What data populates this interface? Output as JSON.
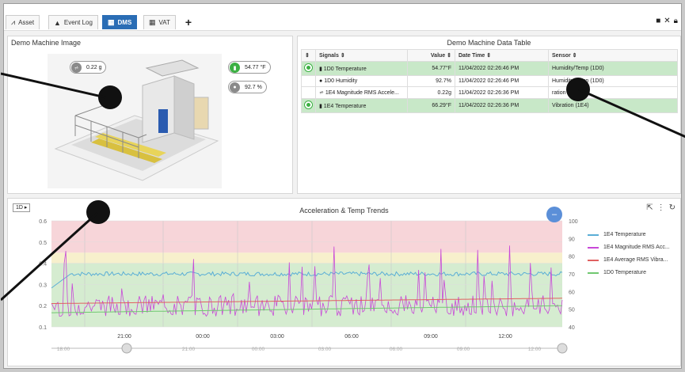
{
  "tabs": [
    {
      "label": "Asset",
      "icon": "asset-chart-icon"
    },
    {
      "label": "Event Log",
      "icon": "warning-triangle-icon"
    },
    {
      "label": "DMS",
      "icon": "dms-grid-icon"
    },
    {
      "label": "VAT",
      "icon": "vat-grid-icon"
    }
  ],
  "image_panel": {
    "title": "Demo Machine Image",
    "badges": {
      "vibration": "0.22 g",
      "temperature": "54.77 °F",
      "humidity": "92.7 %"
    }
  },
  "table_panel": {
    "title": "Demo Machine Data Table",
    "headers": [
      "Signals ⇕",
      "Value ⇕",
      "Date Time ⇕",
      "Sensor ⇕"
    ],
    "rows": [
      {
        "signal": "1D0 Temperature",
        "value": "54.77°F",
        "datetime": "11/04/2022 02:26:46 PM",
        "sensor": "Humidity/Temp (1D0)",
        "highlight": true
      },
      {
        "signal": "1D0 Humidity",
        "value": "92.7%",
        "datetime": "11/04/2022 02:26:46 PM",
        "sensor": "Humidity/Temp (1D0)",
        "highlight": false
      },
      {
        "signal": "1E4 Magnitude RMS Accele...",
        "value": "0.22g",
        "datetime": "11/04/2022 02:26:36 PM",
        "sensor": "ration (1E4)",
        "highlight": false
      },
      {
        "signal": "1E4 Temperature",
        "value": "66.29°F",
        "datetime": "11/04/2022 02:26:36 PM",
        "sensor": "Vibration (1E4)",
        "highlight": true
      }
    ]
  },
  "trend_panel": {
    "title": "Acceleration & Temp Trends",
    "range_label": "1D",
    "collapse_glyph": "–"
  },
  "chart_data": {
    "type": "line",
    "title": "Acceleration & Temp Trends",
    "x_ticks": [
      "21:00",
      "00:00",
      "03:00",
      "06:00",
      "09:00",
      "12:00"
    ],
    "navigator_ticks": [
      "18:00",
      "21:00",
      "00:00",
      "03:00",
      "06:00",
      "09:00",
      "12:00"
    ],
    "y_left": {
      "ticks": [
        0.1,
        0.2,
        0.3,
        0.4,
        0.5,
        0.6
      ],
      "range": [
        0.1,
        0.6
      ]
    },
    "y_right": {
      "ticks": [
        40,
        50,
        60,
        70,
        80,
        90,
        100
      ],
      "range": [
        40,
        100
      ]
    },
    "bands": [
      {
        "from": 0.1,
        "to": 0.4,
        "color": "#d5ecd0"
      },
      {
        "from": 0.4,
        "to": 0.45,
        "color": "#f7f0cc"
      },
      {
        "from": 0.45,
        "to": 0.6,
        "color": "#f7d5d9"
      }
    ],
    "series": [
      {
        "name": "1E4 Temperature",
        "color": "#5aaed6",
        "axis": "right",
        "baseline": 70,
        "noise": 1.2,
        "start": 62
      },
      {
        "name": "1E4 Magnitude RMS Acc...",
        "color": "#c848d8",
        "axis": "left",
        "baseline": 0.2,
        "noise": 0.05,
        "spikes": 0.5
      },
      {
        "name": "1E4 Average RMS Vibra...",
        "color": "#e06060",
        "axis": "left",
        "baseline": 0.21,
        "end": 0.235
      },
      {
        "name": "1D0 Temperature",
        "color": "#70c870",
        "axis": "right",
        "baseline": 48,
        "end": 52
      }
    ]
  }
}
